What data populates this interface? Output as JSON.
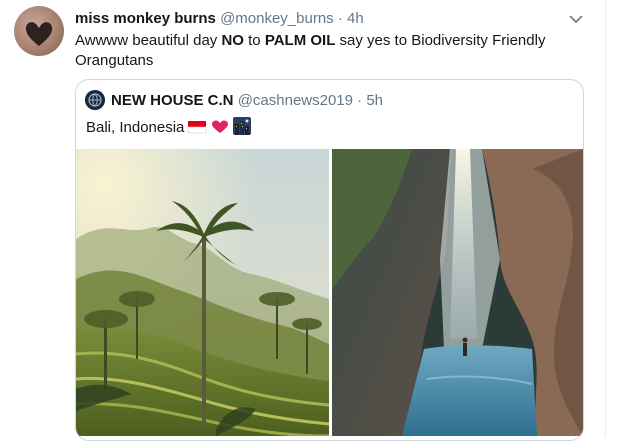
{
  "tweet": {
    "author_name": "miss monkey burns",
    "author_handle": "@monkey_burns",
    "separator": "·",
    "time": "4h",
    "text_parts": {
      "p1": "Awwww beautiful day ",
      "p2": "NO",
      "p3": " to ",
      "p4": "PALM OIL",
      "p5": " say yes to Biodiversity Friendly Orangutans"
    },
    "menu_icon": "chevron-down-icon"
  },
  "quoted_tweet": {
    "author_name": "NEW HOUSE C.N",
    "author_handle": "@cashnews2019",
    "separator": "·",
    "time": "5h",
    "text": "Bali, Indonesia",
    "emojis": [
      "indonesia-flag-icon",
      "heart-icon",
      "night-city-icon"
    ],
    "media": [
      "rice-terrace-palm-photo",
      "waterfall-cave-photo"
    ]
  },
  "colors": {
    "text": "#14171a",
    "secondary": "#657786",
    "border": "#ccd6dd",
    "heart": "#e0245e",
    "flag_red": "#e70011"
  }
}
